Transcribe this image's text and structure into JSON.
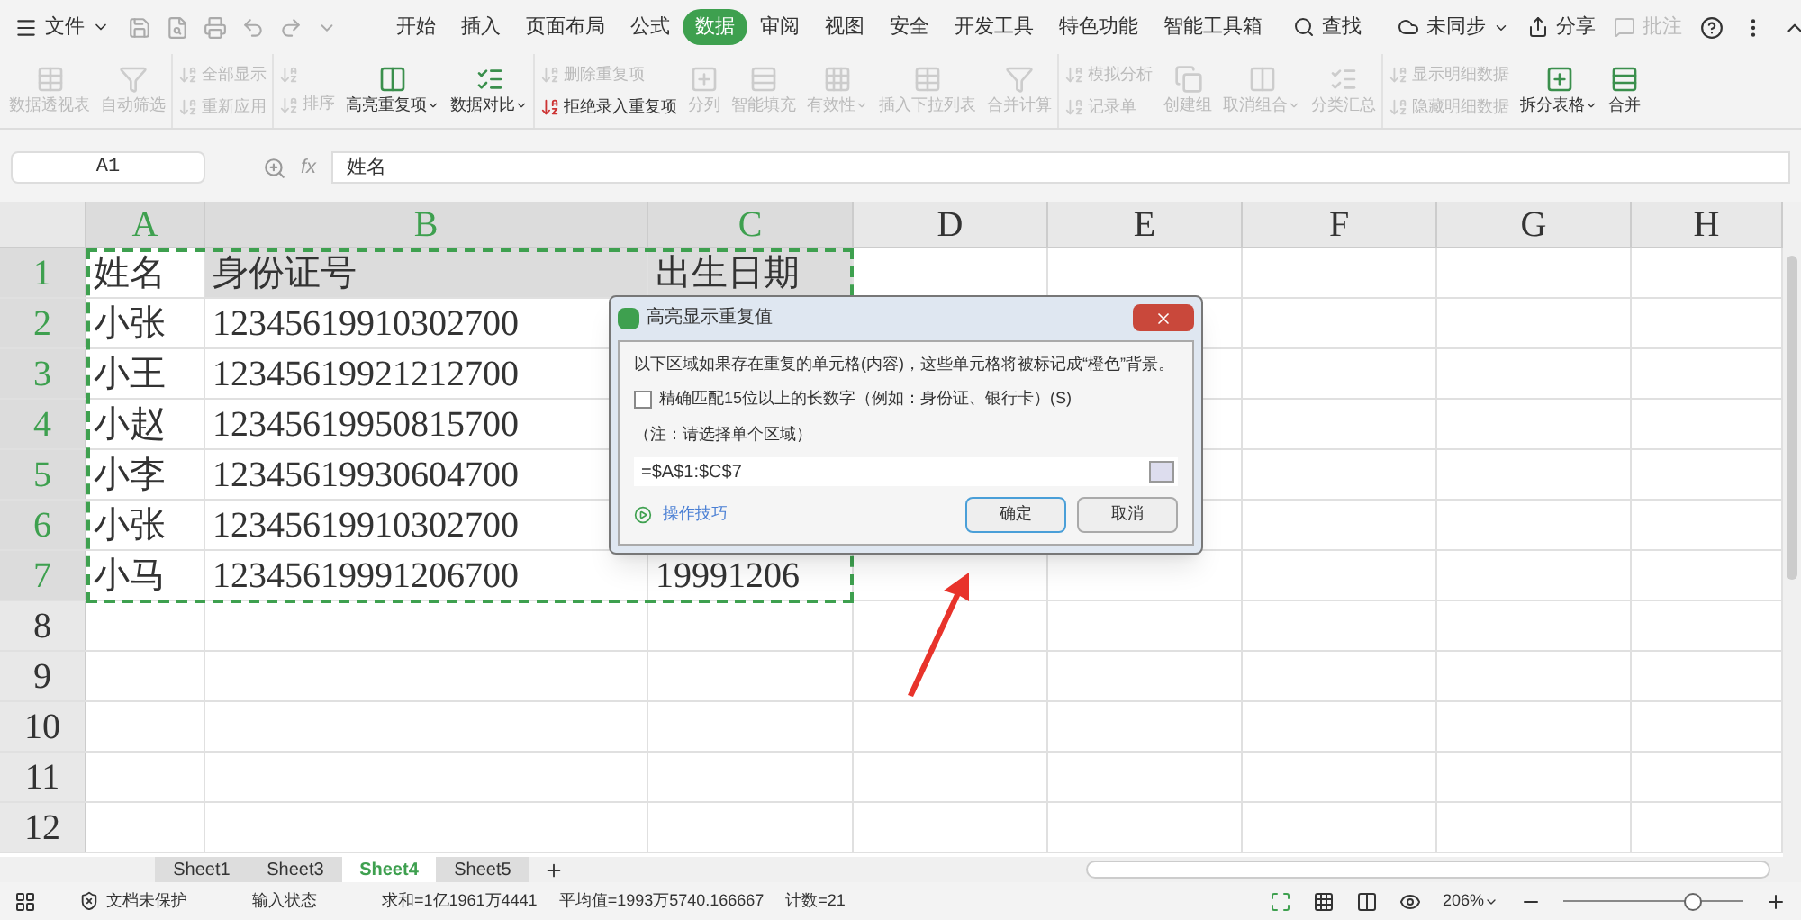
{
  "menu": {
    "file": "文件",
    "tabs": [
      {
        "label": "开始",
        "selected": false
      },
      {
        "label": "插入",
        "selected": false
      },
      {
        "label": "页面布局",
        "selected": false
      },
      {
        "label": "公式",
        "selected": false
      },
      {
        "label": "数据",
        "selected": true
      },
      {
        "label": "审阅",
        "selected": false
      },
      {
        "label": "视图",
        "selected": false
      },
      {
        "label": "安全",
        "selected": false
      },
      {
        "label": "开发工具",
        "selected": false
      },
      {
        "label": "特色功能",
        "selected": false
      },
      {
        "label": "智能工具箱",
        "selected": false
      }
    ],
    "search": "查找",
    "sync": "未同步",
    "share": "分享",
    "comment": {
      "label": "批注",
      "disabled": true
    }
  },
  "ribbon": [
    {
      "kind": "large",
      "label": "数据透视表",
      "disabled": true,
      "dropdown": false
    },
    {
      "kind": "large",
      "label": "自动筛选",
      "disabled": true,
      "dropdown": false
    },
    {
      "kind": "stack",
      "items": [
        {
          "label": "全部显示",
          "disabled": true
        },
        {
          "label": "重新应用",
          "disabled": true
        }
      ]
    },
    {
      "kind": "stack",
      "items": [
        {
          "disabled": true
        },
        {
          "label": "排序",
          "disabled": true
        }
      ]
    },
    {
      "kind": "large",
      "label": "高亮重复项",
      "disabled": false,
      "dropdown": true
    },
    {
      "kind": "large",
      "label": "数据对比",
      "disabled": false,
      "dropdown": true
    },
    {
      "kind": "stack",
      "items": [
        {
          "label": "删除重复项",
          "disabled": true
        },
        {
          "label": "拒绝录入重复项",
          "disabled": false
        }
      ]
    },
    {
      "kind": "large",
      "label": "分列",
      "disabled": true,
      "dropdown": false
    },
    {
      "kind": "large",
      "label": "智能填充",
      "disabled": true,
      "dropdown": false
    },
    {
      "kind": "large",
      "label": "有效性",
      "disabled": true,
      "dropdown": true
    },
    {
      "kind": "large",
      "label": "插入下拉列表",
      "disabled": true,
      "dropdown": false
    },
    {
      "kind": "large",
      "label": "合并计算",
      "disabled": true,
      "dropdown": false
    },
    {
      "kind": "stack",
      "items": [
        {
          "label": "模拟分析",
          "disabled": true
        },
        {
          "label": "记录单",
          "disabled": true
        }
      ]
    },
    {
      "kind": "large",
      "label": "创建组",
      "disabled": true,
      "dropdown": false
    },
    {
      "kind": "large",
      "label": "取消组合",
      "disabled": true,
      "dropdown": true
    },
    {
      "kind": "large",
      "label": "分类汇总",
      "disabled": true,
      "dropdown": false
    },
    {
      "kind": "stack",
      "items": [
        {
          "label": "显示明细数据",
          "disabled": true
        },
        {
          "label": "隐藏明细数据",
          "disabled": true
        }
      ]
    },
    {
      "kind": "large",
      "label": "拆分表格",
      "disabled": false,
      "dropdown": true
    },
    {
      "kind": "large",
      "label": "合并",
      "disabled": false,
      "dropdown": false
    }
  ],
  "formula_bar": {
    "cell": "A1",
    "fx": "fx",
    "value": "姓名"
  },
  "columns": [
    {
      "label": "A",
      "selected": true
    },
    {
      "label": "B",
      "selected": true
    },
    {
      "label": "C",
      "selected": true
    },
    {
      "label": "D",
      "selected": false
    },
    {
      "label": "E",
      "selected": false
    },
    {
      "label": "F",
      "selected": false
    },
    {
      "label": "G",
      "selected": false
    },
    {
      "label": "H",
      "selected": false
    }
  ],
  "rows": [
    {
      "number": "1",
      "selected": true,
      "cells": [
        "姓名",
        "身份证号",
        "出生日期"
      ]
    },
    {
      "number": "2",
      "selected": true,
      "cells": [
        "小张",
        "12345619910302700",
        ""
      ]
    },
    {
      "number": "3",
      "selected": true,
      "cells": [
        "小王",
        "12345619921212700",
        ""
      ]
    },
    {
      "number": "4",
      "selected": true,
      "cells": [
        "小赵",
        "12345619950815700",
        ""
      ]
    },
    {
      "number": "5",
      "selected": true,
      "cells": [
        "小李",
        "12345619930604700",
        ""
      ]
    },
    {
      "number": "6",
      "selected": true,
      "cells": [
        "小张",
        "12345619910302700",
        ""
      ]
    },
    {
      "number": "7",
      "selected": true,
      "cells": [
        "小马",
        "12345619991206700",
        "19991206"
      ]
    },
    {
      "number": "8",
      "selected": false,
      "cells": [
        "",
        "",
        ""
      ]
    },
    {
      "number": "9",
      "selected": false,
      "cells": [
        "",
        "",
        ""
      ]
    },
    {
      "number": "10",
      "selected": false,
      "cells": [
        "",
        "",
        ""
      ]
    },
    {
      "number": "11",
      "selected": false,
      "cells": [
        "",
        "",
        ""
      ]
    },
    {
      "number": "12",
      "selected": false,
      "cells": [
        "",
        "",
        ""
      ]
    }
  ],
  "dialog": {
    "title": "高亮显示重复值",
    "message": "以下区域如果存在重复的单元格(内容)，这些单元格将被标记成“橙色”背景。",
    "checkbox": {
      "label": "精确匹配15位以上的长数字（例如：身份证、银行卡）(S)",
      "checked": false
    },
    "note": "（注：请选择单个区域）",
    "range": "=$A$1:$C$7",
    "tips": "操作技巧",
    "ok": "确定",
    "cancel": "取消"
  },
  "sheets": [
    {
      "label": "Sheet1",
      "selected": false
    },
    {
      "label": "Sheet3",
      "selected": false
    },
    {
      "label": "Sheet4",
      "selected": true
    },
    {
      "label": "Sheet5",
      "selected": false
    }
  ],
  "status_bar": {
    "protection": "文档未保护",
    "mode": "输入状态",
    "sum": "求和=1亿1961万4441",
    "average": "平均值=1993万5740.166667",
    "count": "计数=21",
    "zoom": "206%",
    "zoom_slider": {
      "level": 0.72
    }
  }
}
